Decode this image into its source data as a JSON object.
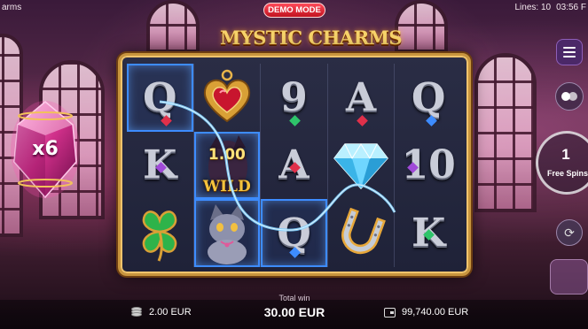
{
  "game": {
    "title_fragment": "arms",
    "logo": "MYSTIC CHARMS",
    "demo_badge": "DEMO MODE"
  },
  "status": {
    "lines": "Lines: 10",
    "time": "03:56 F"
  },
  "multiplier": {
    "label": "x6"
  },
  "reels": {
    "columns": 5,
    "rows": 3,
    "grid": [
      [
        "Q",
        "heart-locket",
        "9",
        "A",
        "Q"
      ],
      [
        "K",
        "wild-multiplier",
        "A",
        "diamond",
        "10"
      ],
      [
        "four-leaf-clover",
        "wild-cat",
        "Q",
        "horseshoe",
        "K"
      ]
    ],
    "winning_cells": [
      [
        0,
        0
      ],
      [
        1,
        1
      ],
      [
        2,
        1
      ],
      [
        2,
        2
      ]
    ],
    "wild": {
      "multiplier_text": "1.00",
      "label": "WILD"
    },
    "letter_colors": {
      "accent_red": "#e0304a",
      "accent_green": "#2ec46a",
      "accent_purple": "#a04ad8",
      "accent_blue": "#3d8cff"
    }
  },
  "controls": {
    "menu_icon": "hamburger-menu-icon",
    "toggle_icon": "toggle-switch-icon",
    "free_spins": {
      "count": "1",
      "label": "Free Spins"
    },
    "autoplay_icon": "autoplay-icon"
  },
  "footer": {
    "bet": "2.00 EUR",
    "total_win_label": "Total win",
    "total_win_value": "30.00 EUR",
    "balance": "99,740.00 EUR"
  },
  "colors": {
    "frame_gold": "#c8953e",
    "win_highlight": "#3d8cff",
    "demo_red": "#c2121f",
    "menu_purple": "#4b2868"
  }
}
